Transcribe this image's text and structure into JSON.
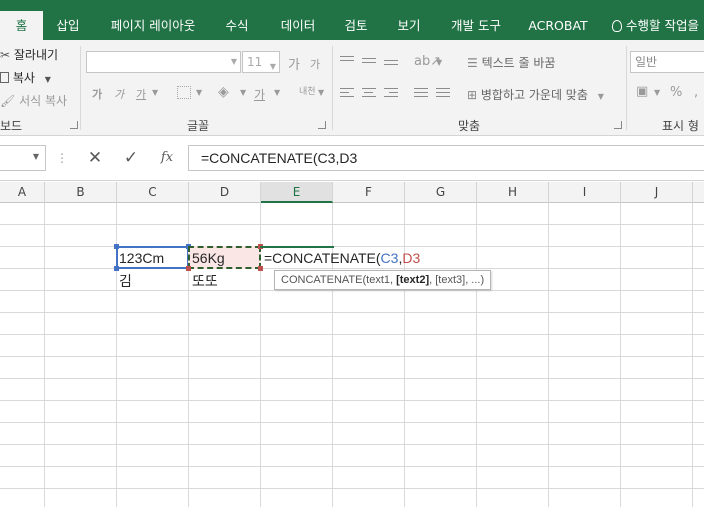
{
  "ribbon_tabs": [
    "홈",
    "삽입",
    "페이지 레이아웃",
    "수식",
    "데이터",
    "검토",
    "보기",
    "개발 도구",
    "ACROBAT"
  ],
  "active_tab": "홈",
  "tell_me": "수행할 작업을",
  "clipboard": {
    "cut": "잘라내기",
    "copy": "복사",
    "format_painter": "서식 복사",
    "group_label": "보드"
  },
  "font": {
    "font_name": "",
    "font_size": "11",
    "grow": "가",
    "shrink": "가",
    "bold": "가",
    "italic": "가",
    "underline": "가",
    "font_color": "가",
    "phonetic": "내천",
    "group_label": "글꼴"
  },
  "alignment": {
    "wrap_text": "텍스트 줄 바꿈",
    "merge_center": "병합하고 가운데 맞춤",
    "group_label": "맞춤"
  },
  "number": {
    "format": "일반",
    "percent": "%",
    "group_label": "표시 형"
  },
  "formula_bar": {
    "name_box": "",
    "cancel": "✕",
    "enter": "✓",
    "fx": "fx",
    "content": "=CONCATENATE(C3,D3"
  },
  "columns": [
    "A",
    "B",
    "C",
    "D",
    "E",
    "F",
    "G",
    "H",
    "I",
    "J"
  ],
  "selected_column": "E",
  "cells": {
    "C3": "123Cm",
    "D3": "56Kg",
    "C4": "김",
    "D4": "또또",
    "E3_prefix": "=CONCATENATE(",
    "E3_ref1": "C3",
    "E3_comma": ",",
    "E3_ref2": "D3"
  },
  "tooltip": {
    "fn": "CONCATENATE(text1, ",
    "current": "[text2]",
    "rest": ", [text3], ...)"
  },
  "colors": {
    "brand": "#217346",
    "ref1": "#4472c4",
    "ref2": "#c0504d"
  }
}
